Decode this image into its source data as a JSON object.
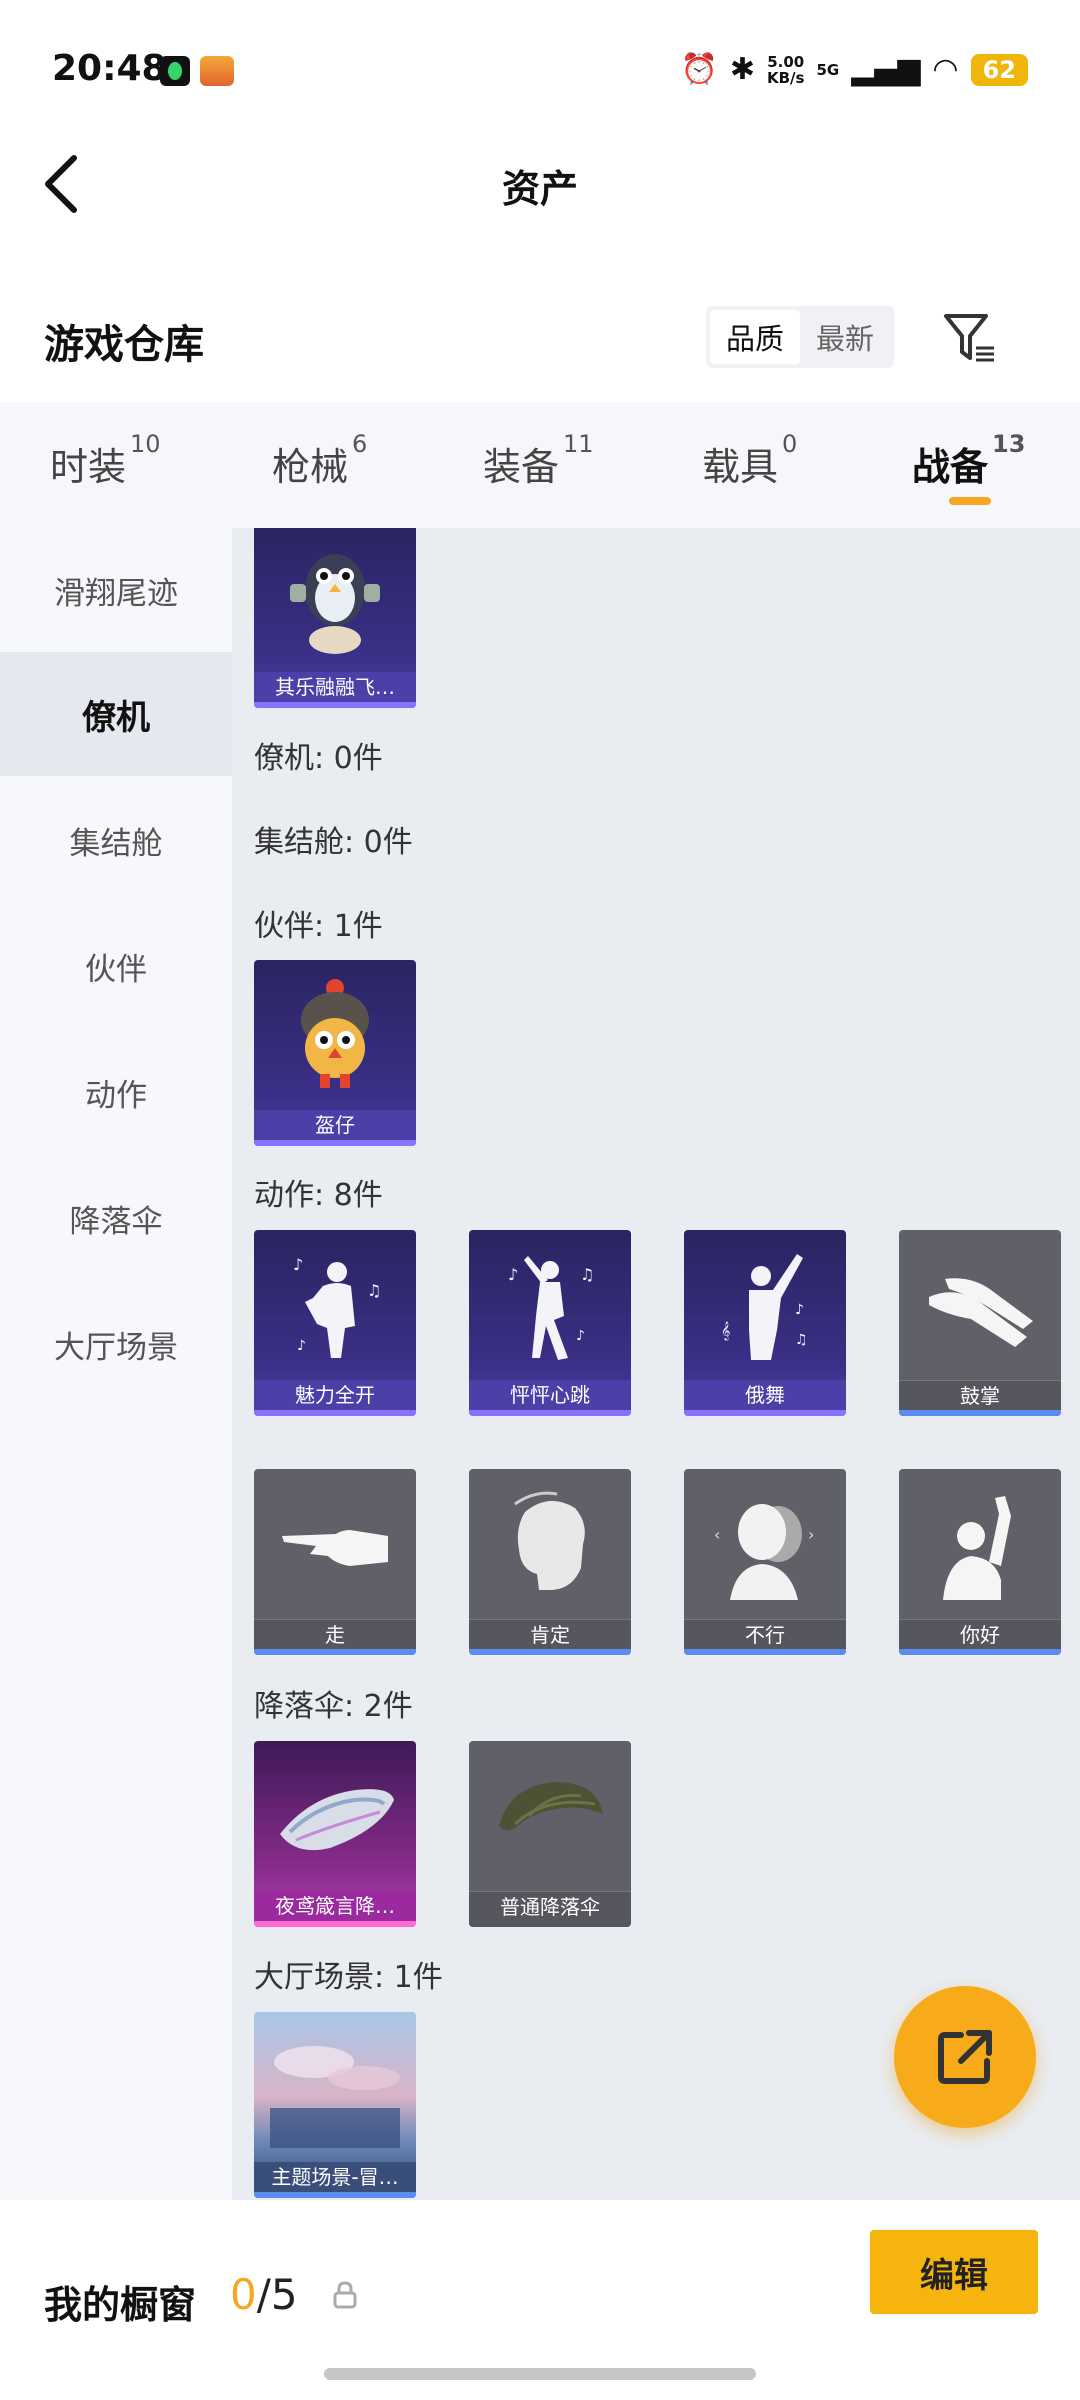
{
  "status_bar": {
    "time": "20:48",
    "speed": "5.00",
    "speed_unit": "KB/s",
    "network": "5G",
    "battery": "62"
  },
  "header": {
    "title": "资产"
  },
  "warehouse": {
    "title": "游戏仓库",
    "sort_options": [
      "品质",
      "最新"
    ],
    "active_sort": "品质"
  },
  "tabs": [
    {
      "label": "时装",
      "count": "10"
    },
    {
      "label": "枪械",
      "count": "6"
    },
    {
      "label": "装备",
      "count": "11"
    },
    {
      "label": "载具",
      "count": "0"
    },
    {
      "label": "战备",
      "count": "13",
      "active": true
    }
  ],
  "sidebar": {
    "items": [
      "滑翔尾迹",
      "僚机",
      "集结舱",
      "伙伴",
      "动作",
      "降落伞",
      "大厅场景"
    ],
    "active": "僚机"
  },
  "sections": {
    "trail_items": [
      "其乐融融飞…"
    ],
    "wingman_label": "僚机: 0件",
    "capsule_label": "集结舱: 0件",
    "partner_label": "伙伴: 1件",
    "partner_items": [
      "盔仔"
    ],
    "action_label": "动作: 8件",
    "action_items": [
      "魅力全开",
      "怦怦心跳",
      "俄舞",
      "鼓掌",
      "走",
      "肯定",
      "不行",
      "你好"
    ],
    "parachute_label": "降落伞: 2件",
    "parachute_items": [
      "夜鸢箴言降…",
      "普通降落伞"
    ],
    "scene_label": "大厅场景: 1件",
    "scene_items": [
      "主题场景-冒…"
    ]
  },
  "bottom": {
    "showcase_label": "我的橱窗",
    "showcase_current": "0",
    "showcase_total": "/5",
    "edit_label": "编辑"
  },
  "colors": {
    "accent": "#f5a623",
    "button": "#f6b40e",
    "purple_card": "#4b3fa8",
    "gray_card": "#5f6068"
  }
}
